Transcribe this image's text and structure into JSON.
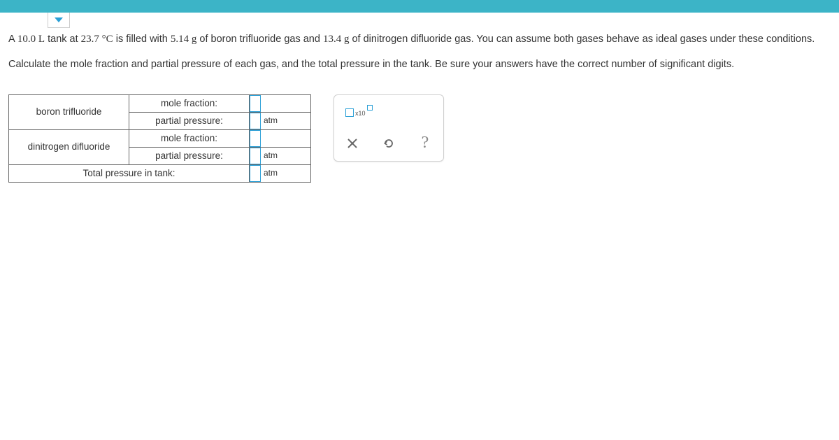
{
  "problem": {
    "sentence1_parts": {
      "prefix": "A ",
      "volume": "10.0 L",
      "mid1": " tank at ",
      "temperature": "23.7 °C",
      "mid2": " is filled with ",
      "mass1": "5.14 g",
      "mid3": " of boron trifluoride gas and ",
      "mass2": "13.4 g",
      "suffix": " of dinitrogen difluoride gas. You can assume both gases behave as ideal gases under these conditions."
    },
    "sentence2": "Calculate the mole fraction and partial pressure of each gas, and the total pressure in the tank. Be sure your answers have the correct number of significant digits."
  },
  "table": {
    "rows": [
      {
        "gas": "boron trifluoride",
        "mole_label": "mole fraction:",
        "pp_label": "partial pressure:",
        "unit": "atm"
      },
      {
        "gas": "dinitrogen difluoride",
        "mole_label": "mole fraction:",
        "pp_label": "partial pressure:",
        "unit": "atm"
      }
    ],
    "total_label": "Total pressure in tank:",
    "total_unit": "atm"
  },
  "toolbox": {
    "sci_label": "x10"
  }
}
